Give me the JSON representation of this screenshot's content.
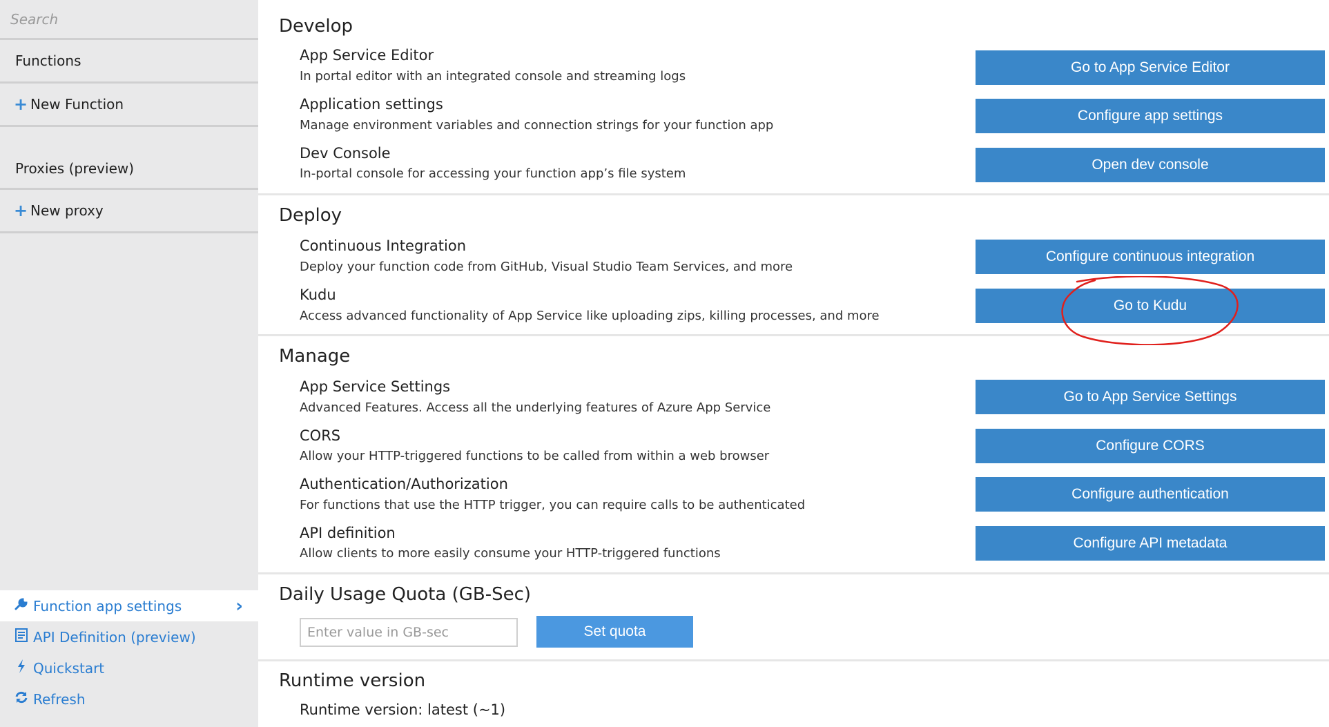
{
  "sidebar": {
    "search_placeholder": "Search",
    "functions_label": "Functions",
    "new_function_label": "New Function",
    "proxies_label": "Proxies (preview)",
    "new_proxy_label": "New proxy",
    "bottom_items": [
      {
        "label": "Function app settings",
        "icon": "wrench-icon",
        "active": true
      },
      {
        "label": "API Definition (preview)",
        "icon": "document-icon"
      },
      {
        "label": "Quickstart",
        "icon": "lightning-icon"
      },
      {
        "label": "Refresh",
        "icon": "refresh-icon"
      }
    ]
  },
  "develop": {
    "title": "Develop",
    "rows": [
      {
        "title": "App Service Editor",
        "desc": "In portal editor with an integrated console and streaming logs",
        "button": "Go to App Service Editor"
      },
      {
        "title": "Application settings",
        "desc": "Manage environment variables and connection strings for your function app",
        "button": "Configure app settings"
      },
      {
        "title": "Dev Console",
        "desc": "In-portal console for accessing your function app’s file system",
        "button": "Open dev console"
      }
    ]
  },
  "deploy": {
    "title": "Deploy",
    "rows": [
      {
        "title": "Continuous Integration",
        "desc": "Deploy your function code from GitHub, Visual Studio Team Services, and more",
        "button": "Configure continuous integration"
      },
      {
        "title": "Kudu",
        "desc": "Access advanced functionality of App Service like uploading zips, killing processes, and more",
        "button": "Go to Kudu"
      }
    ]
  },
  "manage": {
    "title": "Manage",
    "rows": [
      {
        "title": "App Service Settings",
        "desc": "Advanced Features. Access all the underlying features of Azure App Service",
        "button": "Go to App Service Settings"
      },
      {
        "title": "CORS",
        "desc": "Allow your HTTP-triggered functions to be called from within a web browser",
        "button": "Configure CORS"
      },
      {
        "title": "Authentication/Authorization",
        "desc": "For functions that use the HTTP trigger, you can require calls to be authenticated",
        "button": "Configure authentication"
      },
      {
        "title": "API definition",
        "desc": "Allow clients to more easily consume your HTTP-triggered functions",
        "button": "Configure API metadata"
      }
    ]
  },
  "quota": {
    "title": "Daily Usage Quota (GB-Sec)",
    "input_placeholder": "Enter value in GB-sec",
    "button": "Set quota"
  },
  "runtime": {
    "title": "Runtime version",
    "value": "Runtime version: latest (~1)"
  },
  "colors": {
    "button_blue": "#3a87c9",
    "link_blue": "#2a7dd1",
    "annotation_red": "#e0201c"
  }
}
